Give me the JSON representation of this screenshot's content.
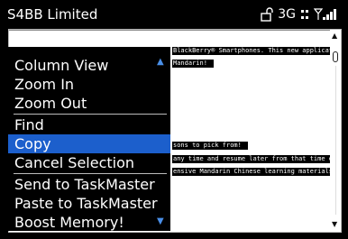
{
  "statusbar": {
    "title": "S4BB Limited",
    "network": "3G",
    "icons": [
      "lock-icon",
      "data-transfer-icon",
      "signal-strength-icon"
    ]
  },
  "content": {
    "lines": [
      "BlackBerry® Smartphones. This new applicatio",
      "Mandarin!",
      "sons to pick from!",
      "any time and resume later from that time onw",
      "ensive Mandarin Chinese learning materials w"
    ]
  },
  "menu": {
    "items": [
      {
        "label": "Column View"
      },
      {
        "label": "Zoom In"
      },
      {
        "label": "Zoom Out"
      },
      {
        "label": "Find"
      },
      {
        "label": "Copy"
      },
      {
        "label": "Cancel Selection"
      },
      {
        "label": "Send to TaskMaster"
      },
      {
        "label": "Paste to TaskMaster"
      },
      {
        "label": "Boost Memory!"
      }
    ],
    "selected": "Copy",
    "colors": {
      "highlight": "#1c5fcc",
      "background": "#000000",
      "arrow": "#4a8fe8"
    }
  }
}
